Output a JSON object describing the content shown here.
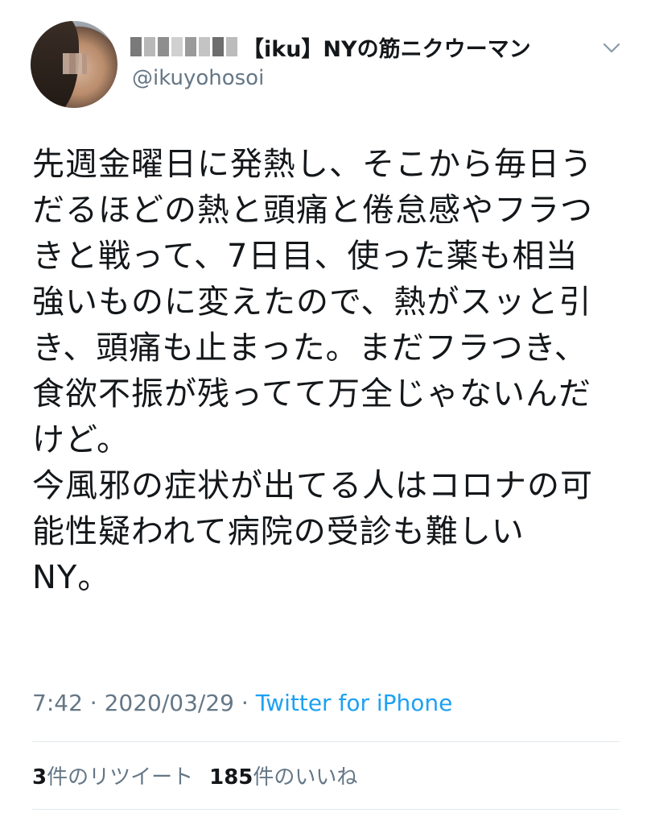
{
  "author": {
    "display_name": "【iku】NYの筋ニクウーマン",
    "handle": "@ikuyohosoi"
  },
  "tweet": {
    "text": "先週金曜日に発熱し、そこから毎日う\nだるほどの熱と頭痛と倦怠感やフラつ\nきと戦って、7日目、使った薬も相当\n強いものに変えたので、熱がスッと引\nき、頭痛も止まった。まだフラつき、\n食欲不振が残ってて万全じゃないんだ\nけど。\n今風邪の症状が出てる人はコロナの可\n能性疑われて病院の受診も難しい\nNY。"
  },
  "meta": {
    "time": "7:42",
    "separator": "·",
    "date": "2020/03/29",
    "source": "Twitter for iPhone"
  },
  "stats": {
    "retweet_count": "3",
    "retweet_label": "件のリツイート",
    "like_count": "185",
    "like_label": "件のいいね"
  },
  "icons": {
    "avatar": "avatar-photo",
    "more": "chevron-down-icon"
  },
  "colors": {
    "link": "#1da1f2",
    "secondary_text": "#657786",
    "divider": "#e1e8ed"
  }
}
